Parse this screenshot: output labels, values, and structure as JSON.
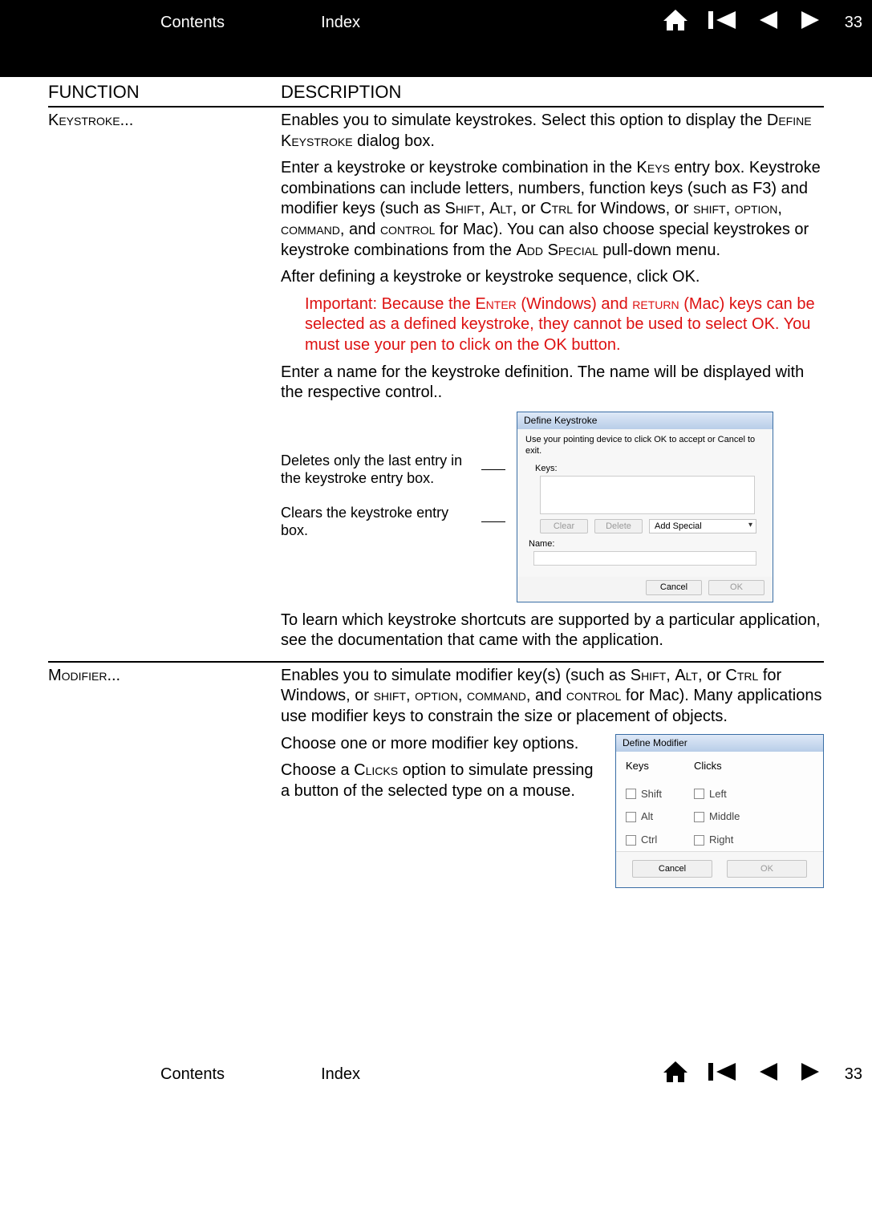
{
  "page_number": "33",
  "nav": {
    "contents": "Contents",
    "index": "Index"
  },
  "table": {
    "headers": {
      "function": "FUNCTION",
      "description": "DESCRIPTION"
    },
    "keystroke": {
      "name": "Keystroke...",
      "p1a": "Enables you to simulate keystrokes. Select this option to display the ",
      "p1b": "Define Keystroke",
      "p1c": " dialog box.",
      "p2a": "Enter a keystroke or keystroke combination in the ",
      "p2b": "Keys",
      "p2c": " entry box. Keystroke combinations can include letters, numbers, function keys (such as F3) and modifier keys (such as ",
      "p2d": "Shift",
      "p2e": ", ",
      "p2f": "Alt",
      "p2g": ", or ",
      "p2h": "Ctrl",
      "p2i": " for Windows, or ",
      "p2j": "shift",
      "p2k": ", ",
      "p2l": "option",
      "p2m": ", ",
      "p2n": "command",
      "p2o": ", and ",
      "p2p": "control",
      "p2q": " for Mac). You can also choose special keystrokes or keystroke combinations from the ",
      "p2r": "Add Special",
      "p2s": " pull-down menu.",
      "p3": "After defining a keystroke or keystroke sequence, click OK.",
      "imp_a": "Important: Because the ",
      "imp_b": "Enter",
      "imp_c": " (Windows) and ",
      "imp_d": "return",
      "imp_e": " (Mac) keys can be selected as a defined keystroke, they cannot be used to select OK. You must use your pen to click on the OK button.",
      "p4": "Enter a name for the keystroke definition. The name will be displayed with the respective control..",
      "anno_delete": "Deletes only the last entry in the keystroke entry box.",
      "anno_clear": "Clears the keystroke entry box.",
      "p5": "To learn which keystroke shortcuts are supported by a particular application, see the documentation that came with the application."
    },
    "modifier": {
      "name": "Modifier...",
      "p1a": "Enables you to simulate modifier key(s) (such as ",
      "p1b": "Shift",
      "p1c": ", ",
      "p1d": "Alt",
      "p1e": ", or ",
      "p1f": "Ctrl",
      "p1g": " for Windows, or ",
      "p1h": "shift",
      "p1i": ", ",
      "p1j": "option",
      "p1k": ", ",
      "p1l": "command",
      "p1m": ", and ",
      "p1n": "control",
      "p1o": " for Mac). Many applications use modifier keys to constrain the size or placement of objects.",
      "p2": "Choose one or more modifier key options.",
      "p3a": "Choose a ",
      "p3b": "Clicks",
      "p3c": " option to simulate pressing a button of the selected type on a mouse."
    }
  },
  "dlg_keystroke": {
    "title": "Define Keystroke",
    "msg": "Use your pointing device to click OK to accept or Cancel to exit.",
    "keys_label": "Keys:",
    "clear": "Clear",
    "delete": "Delete",
    "add_special": "Add Special",
    "name_label": "Name:",
    "cancel": "Cancel",
    "ok": "OK"
  },
  "dlg_modifier": {
    "title": "Define Modifier",
    "keys_header": "Keys",
    "clicks_header": "Clicks",
    "shift": "Shift",
    "alt": "Alt",
    "ctrl": "Ctrl",
    "left": "Left",
    "middle": "Middle",
    "right": "Right",
    "cancel": "Cancel",
    "ok": "OK"
  }
}
